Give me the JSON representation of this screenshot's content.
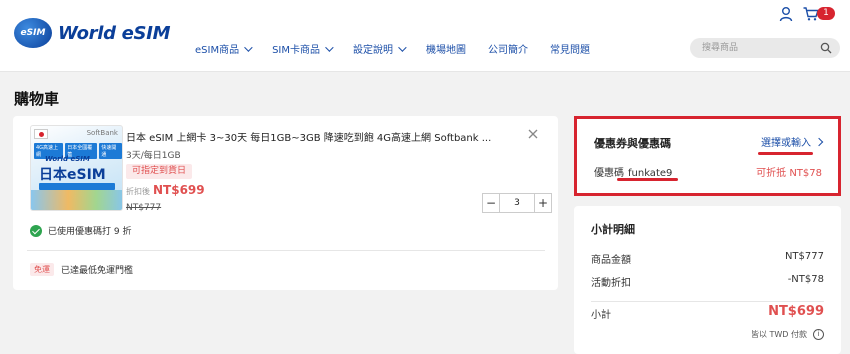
{
  "header": {
    "logo_badge": "eSIM",
    "logo_text": "World eSIM",
    "nav": [
      {
        "label": "eSIM商品",
        "dropdown": true
      },
      {
        "label": "SIM卡商品",
        "dropdown": true
      },
      {
        "label": "設定說明",
        "dropdown": true
      },
      {
        "label": "機場地圖",
        "dropdown": false
      },
      {
        "label": "公司簡介",
        "dropdown": false
      },
      {
        "label": "常見問題",
        "dropdown": false
      }
    ],
    "search_placeholder": "搜尋商品",
    "cart_count": "1"
  },
  "page_title": "購物車",
  "cart_item": {
    "thumb": {
      "carrier": "SoftBank",
      "chips": [
        "4G高速上網",
        "日本全國覆蓋",
        "快速開通"
      ],
      "brand": "World eSIM",
      "headline": "日本eSIM"
    },
    "name": "日本 eSIM 上網卡 3~30天 每日1GB~3GB 降速吃到飽 4G高速上網 Softbank ...",
    "spec": "3天/每日1GB",
    "tag": "可指定到貨日",
    "price_label": "折扣後",
    "price": "NT$699",
    "original_price": "NT$777",
    "quantity": "3",
    "minus": "−",
    "plus": "+",
    "coupon_applied": "已使用優惠碼打 9 折",
    "free_ship_tag": "免運",
    "free_ship_text": "已達最低免運門檻"
  },
  "coupon": {
    "title": "優惠券與優惠碼",
    "select_label": "選擇或輸入",
    "code_label": "優惠碼",
    "code": "funkate9",
    "saving": "可折抵 NT$78"
  },
  "summary": {
    "title": "小計明細",
    "rows": [
      {
        "label": "商品金額",
        "value": "NT$777"
      },
      {
        "label": "活動折扣",
        "value": "-NT$78"
      }
    ],
    "total_label": "小計",
    "total": "NT$699",
    "note": "皆以 TWD 付款",
    "info": "i"
  },
  "colors": {
    "accent_red": "#d7242f",
    "price_red": "#e05050",
    "brand_blue": "#0b3f99",
    "link_blue": "#1c4fa8"
  }
}
